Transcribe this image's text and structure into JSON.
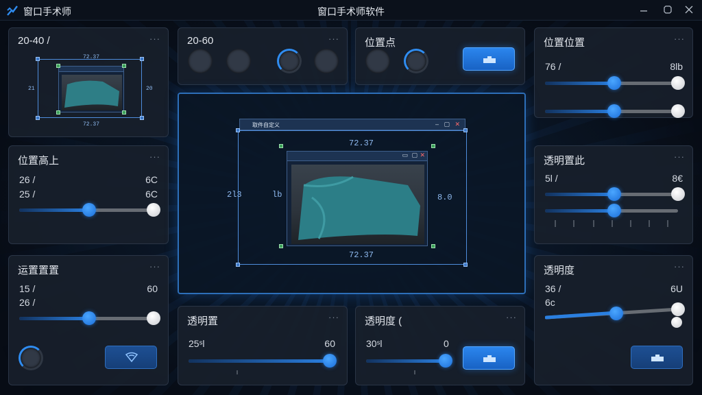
{
  "app": {
    "name": "窗口手术师",
    "window_title": "窗口手术师软件"
  },
  "colors": {
    "accent": "#2f8cf0",
    "panel": "#181f2b",
    "background": "#0a1626"
  },
  "panels": {
    "p1": {
      "title": "20-40 /",
      "diagram": {
        "top": "72.37",
        "left": "21",
        "right": "20",
        "bottom": "72.37"
      }
    },
    "p2": {
      "title": "20-60",
      "rings": [
        {
          "active": false
        },
        {
          "active": false
        },
        {
          "active": true
        },
        {
          "active": false
        }
      ]
    },
    "p3": {
      "title": "位置点",
      "rings": [
        {
          "active": false
        },
        {
          "active": true
        }
      ],
      "button_icon": "puzzle-icon"
    },
    "p4": {
      "title": "位置位置",
      "values": {
        "left": "76 /",
        "right": "8lb"
      },
      "sliders": [
        {
          "value": 0.52,
          "knob": "blue"
        },
        {
          "value": 0.52,
          "knob": "blue"
        }
      ]
    },
    "p5": {
      "title": "位置高上",
      "values": {
        "row1_left": "26 /",
        "row1_right": "6C",
        "row2_left": "25 /",
        "row2_right": "6C"
      },
      "sliders": [
        {
          "value": 0.52
        }
      ]
    },
    "p6": {
      "title": "透明置此",
      "values": {
        "left": "5l /",
        "right": "8€"
      },
      "sliders": [
        {
          "value": 0.52
        },
        {
          "value": 0.52
        }
      ]
    },
    "p7": {
      "title": "运置置置",
      "values": {
        "row1_left": "15 /",
        "row1_right": "60",
        "row2_left": "26 /"
      },
      "sliders": [
        {
          "value": 0.52
        }
      ],
      "button_icon": "wifi-icon"
    },
    "p8": {
      "title": "透明置",
      "values": {
        "left": "25ˢl",
        "right": "60"
      },
      "sliders": [
        {
          "value": 1.0
        }
      ]
    },
    "p9": {
      "title": "透明度 (",
      "values": {
        "left": "30ˢl",
        "right": "0"
      },
      "sliders": [
        {
          "value": 1.0
        }
      ],
      "button_icon": "puzzle-icon"
    },
    "p10": {
      "title": "透明度",
      "values": {
        "row1_left": "36 /",
        "row1_right": "6U",
        "row2_left": "6c"
      },
      "sliders": [
        {
          "value": 0.52
        }
      ],
      "button_icon": "puzzle-icon"
    }
  },
  "preview": {
    "outer_window_title": "取件自定义",
    "dims": {
      "top": "72.37",
      "bottom": "72.37",
      "left": "2l3",
      "mid": "lb",
      "right": "8.0"
    }
  }
}
